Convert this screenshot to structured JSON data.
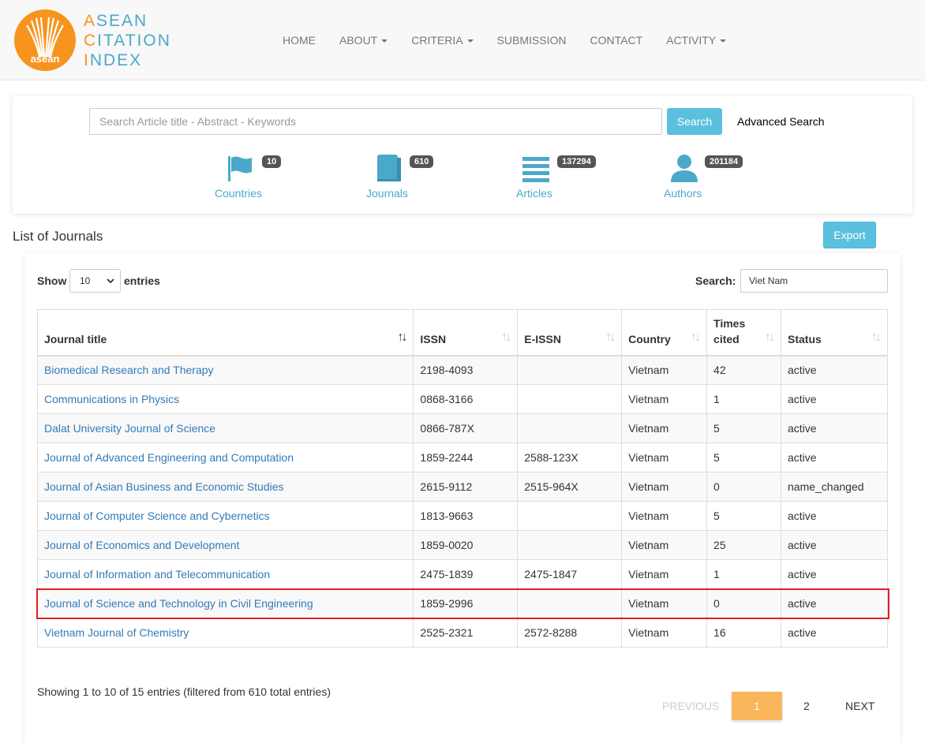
{
  "brand": {
    "lines": [
      {
        "first": "A",
        "rest": "SEAN"
      },
      {
        "first": "C",
        "rest": "ITATION"
      },
      {
        "first": "I",
        "rest": "NDEX"
      }
    ],
    "logo_text": "asean",
    "colors": {
      "orange": "#f7941d",
      "blue": "#4aa9c9"
    }
  },
  "nav": {
    "home": "HOME",
    "about": "ABOUT",
    "criteria": "CRITERIA",
    "submission": "SUBMISSION",
    "contact": "CONTACT",
    "activity": "ACTIVITY"
  },
  "search": {
    "placeholder": "Search Article title - Abstract - Keywords",
    "button": "Search",
    "advanced": "Advanced Search"
  },
  "stats": {
    "countries": {
      "label": "Countries",
      "count": "10",
      "icon": "flag-icon"
    },
    "journals": {
      "label": "Journals",
      "count": "610",
      "icon": "book-icon"
    },
    "articles": {
      "label": "Articles",
      "count": "137294",
      "icon": "list-icon"
    },
    "authors": {
      "label": "Authors",
      "count": "201184",
      "icon": "user-icon"
    }
  },
  "list": {
    "title": "List of Journals",
    "export": "Export",
    "show": "Show",
    "page_size": "10",
    "entries": "entries",
    "search_label": "Search:",
    "search_value": "Viet Nam"
  },
  "table": {
    "headers": {
      "title": "Journal title",
      "issn": "ISSN",
      "eissn": "E-ISSN",
      "country": "Country",
      "times_cited": "Times cited",
      "status": "Status"
    },
    "rows": [
      {
        "title": "Biomedical Research and Therapy",
        "issn": "2198-4093",
        "eissn": "",
        "country": "Vietnam",
        "cited": "42",
        "status": "active"
      },
      {
        "title": "Communications in Physics",
        "issn": "0868-3166",
        "eissn": "",
        "country": "Vietnam",
        "cited": "1",
        "status": "active"
      },
      {
        "title": "Dalat University Journal of Science",
        "issn": "0866-787X",
        "eissn": "",
        "country": "Vietnam",
        "cited": "5",
        "status": "active"
      },
      {
        "title": "Journal of Advanced Engineering and Computation",
        "issn": "1859-2244",
        "eissn": "2588-123X",
        "country": "Vietnam",
        "cited": "5",
        "status": "active"
      },
      {
        "title": "Journal of Asian Business and Economic Studies",
        "issn": "2615-9112",
        "eissn": "2515-964X",
        "country": "Vietnam",
        "cited": "0",
        "status": "name_changed"
      },
      {
        "title": "Journal of Computer Science and Cybernetics",
        "issn": "1813-9663",
        "eissn": "",
        "country": "Vietnam",
        "cited": "5",
        "status": "active"
      },
      {
        "title": "Journal of Economics and Development",
        "issn": "1859-0020",
        "eissn": "",
        "country": "Vietnam",
        "cited": "25",
        "status": "active"
      },
      {
        "title": "Journal of Information and Telecommunication",
        "issn": "2475-1839",
        "eissn": "2475-1847",
        "country": "Vietnam",
        "cited": "1",
        "status": "active"
      },
      {
        "title": "Journal of Science and Technology in Civil Engineering",
        "issn": "1859-2996",
        "eissn": "",
        "country": "Vietnam",
        "cited": "0",
        "status": "active"
      },
      {
        "title": "Vietnam Journal of Chemistry",
        "issn": "2525-2321",
        "eissn": "2572-8288",
        "country": "Vietnam",
        "cited": "16",
        "status": "active"
      }
    ]
  },
  "footer": {
    "info": "Showing 1 to 10 of 15 entries (filtered from 610 total entries)",
    "previous": "PREVIOUS",
    "page1": "1",
    "page2": "2",
    "next": "NEXT"
  }
}
